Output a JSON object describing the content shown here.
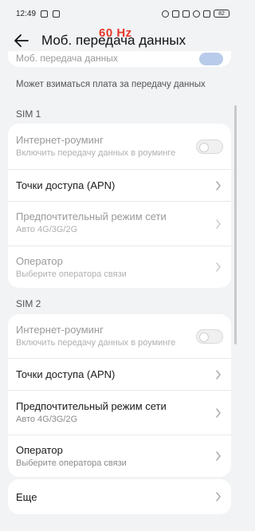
{
  "status_bar": {
    "time": "12:49",
    "battery": "82",
    "icons": [
      "sim-icon",
      "battery-saver-icon",
      "speed-icon",
      "nfc-icon",
      "vibrate-icon",
      "wifi-icon",
      "signal-icon"
    ]
  },
  "header": {
    "title": "Моб. передача данных",
    "back_icon": "back-arrow-icon",
    "overlay": "60 Hz"
  },
  "faded_row": {
    "label": "Моб. передача данных"
  },
  "note": "Может взиматься плата за передачу данных",
  "sim1": {
    "label": "SIM 1",
    "roaming_title": "Интернет-роуминг",
    "roaming_sub": "Включить передачу данных в роуминге",
    "apn": "Точки доступа (APN)",
    "mode_title": "Предпочтительный режим сети",
    "mode_sub": "Авто 4G/3G/2G",
    "operator_title": "Оператор",
    "operator_sub": "Выберите оператора связи"
  },
  "sim2": {
    "label": "SIM 2",
    "roaming_title": "Интернет-роуминг",
    "roaming_sub": "Включить передачу данных в роуминге",
    "apn": "Точки доступа (APN)",
    "mode_title": "Предпочтительный режим сети",
    "mode_sub": "Авто 4G/3G/2G",
    "operator_title": "Оператор",
    "operator_sub": "Выберите оператора связи"
  },
  "more": {
    "label": "Еще"
  },
  "colors": {
    "accent": "#e8382c",
    "background": "#f1f3f5",
    "card": "#ffffff"
  }
}
